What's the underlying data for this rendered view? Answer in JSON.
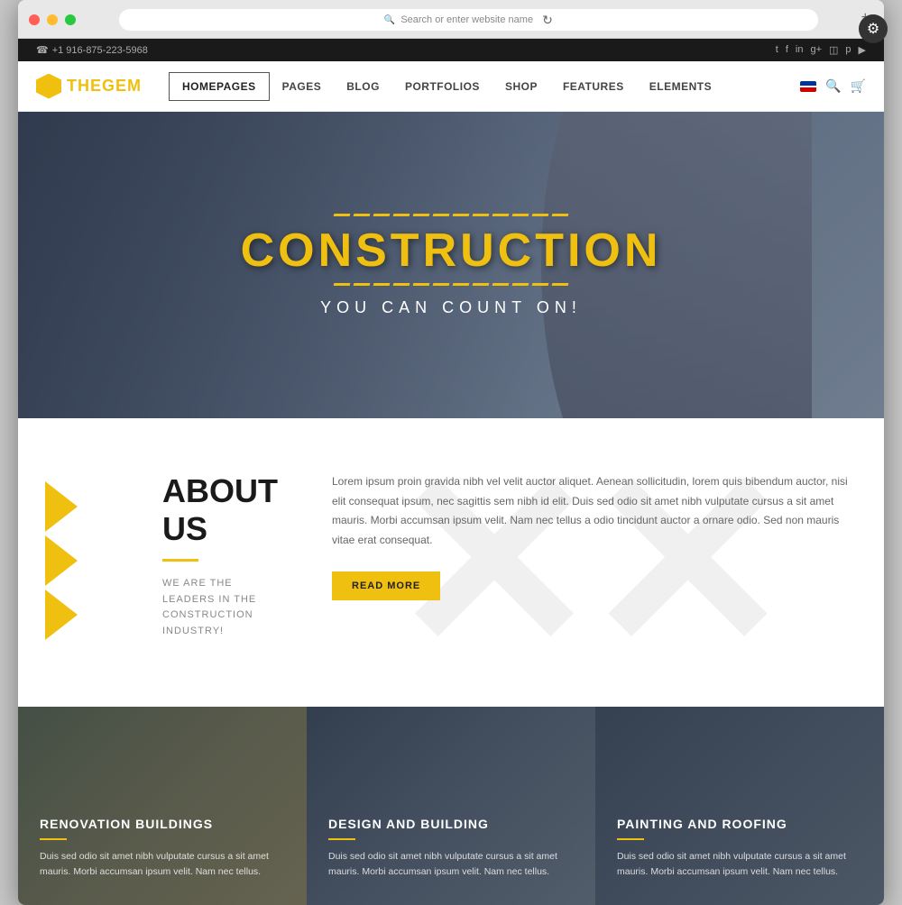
{
  "browser": {
    "address": "Search or enter website name",
    "dots": [
      "red",
      "yellow",
      "green"
    ]
  },
  "topbar": {
    "phone": "+1 916-875-223-5968",
    "phone_icon": "☎",
    "socials": [
      "t",
      "f",
      "in",
      "g+",
      "📷",
      "p",
      "▶"
    ]
  },
  "nav": {
    "logo_text_the": "THE",
    "logo_text_gem": "GEM",
    "links": [
      {
        "label": "HOMEPAGES",
        "active": true
      },
      {
        "label": "PAGES"
      },
      {
        "label": "BLOG"
      },
      {
        "label": "PORTFOLIOS"
      },
      {
        "label": "SHOP"
      },
      {
        "label": "FEATURES"
      },
      {
        "label": "ELEMENTS"
      }
    ]
  },
  "hero": {
    "title": "CONSTRUCTION",
    "subtitle": "YOU CAN COUNT ON!",
    "dashes_count": 12
  },
  "about": {
    "heading": "ABOUT US",
    "tagline": "WE ARE THE LEADERS IN THE\nCONSTRUCTION INDUSTRY!",
    "body": "Lorem ipsum proin gravida nibh vel velit auctor aliquet. Aenean sollicitudin, lorem quis bibendum auctor, nisi elit consequat ipsum, nec sagittis sem nibh id elit. Duis sed odio sit amet nibh vulputate cursus a sit amet mauris. Morbi accumsan ipsum velit. Nam nec tellus a odio tincidunt auctor a ornare odio. Sed non  mauris vitae erat consequat.",
    "read_more": "READ MORE"
  },
  "services": [
    {
      "title": "RENOVATION BUILDINGS",
      "text": "Duis sed odio sit amet nibh vulputate cursus a sit amet mauris. Morbi accumsan ipsum velit. Nam nec tellus."
    },
    {
      "title": "DESIGN AND BUILDING",
      "text": "Duis sed odio sit amet nibh vulputate cursus a sit amet mauris. Morbi accumsan ipsum velit. Nam nec tellus."
    },
    {
      "title": "PAINTING AND ROOFING",
      "text": "Duis sed odio sit amet nibh vulputate cursus a sit amet mauris. Morbi accumsan ipsum velit. Nam nec tellus."
    }
  ],
  "settings_icon": "⚙"
}
